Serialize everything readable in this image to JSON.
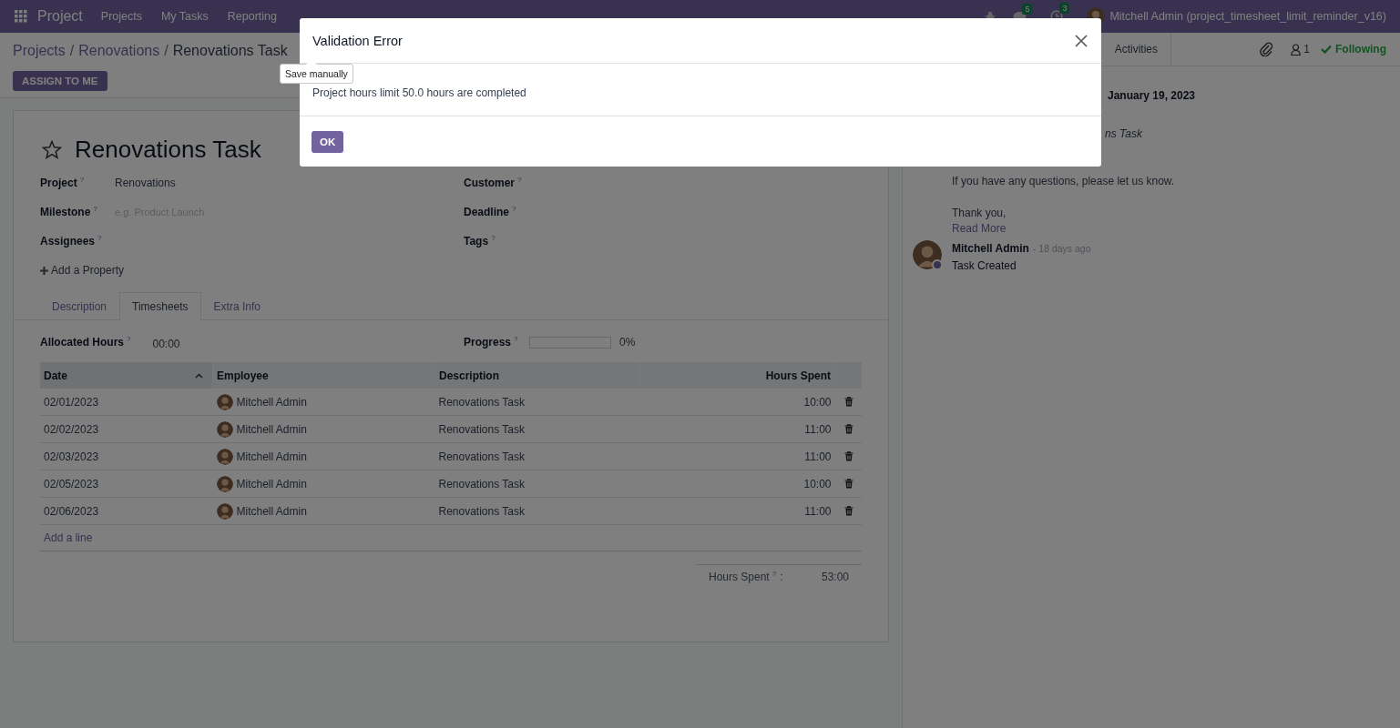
{
  "navbar": {
    "app": "Project",
    "menu": [
      "Projects",
      "My Tasks",
      "Reporting"
    ],
    "messages_count": "5",
    "activities_count": "3",
    "user": "Mitchell Admin (project_timesheet_limit_reminder_v16)"
  },
  "breadcrumb": {
    "items": [
      "Projects",
      "Renovations",
      "Renovations Task"
    ],
    "separator": "/"
  },
  "assign_button": "ASSIGN TO ME",
  "task": {
    "starred": false,
    "title": "Renovations Task",
    "fields_left": [
      {
        "label": "Project",
        "help": "?",
        "value": "Renovations"
      },
      {
        "label": "Milestone",
        "help": "?",
        "placeholder": "e.g. Product Launch"
      },
      {
        "label": "Assignees",
        "help": "?"
      }
    ],
    "fields_right": [
      {
        "label": "Customer",
        "help": "?"
      },
      {
        "label": "Deadline",
        "help": "?"
      },
      {
        "label": "Tags",
        "help": "?"
      }
    ],
    "add_property": "Add a Property"
  },
  "tabs": [
    {
      "label": "Description",
      "selected": false
    },
    {
      "label": "Timesheets",
      "selected": true
    },
    {
      "label": "Extra Info",
      "selected": false
    }
  ],
  "allocated_hours": {
    "label": "Allocated Hours",
    "help": "?",
    "value": "00:00"
  },
  "progress": {
    "label": "Progress",
    "help": "?",
    "level": 0,
    "reading": "0%"
  },
  "table": {
    "columns": [
      {
        "label": "Date",
        "sorted": true
      },
      {
        "label": "Employee",
        "sorted": false
      },
      {
        "label": "Description",
        "sorted": false
      },
      {
        "label": "Hours Spent",
        "sorted": false
      }
    ],
    "rows": [
      {
        "date": "02/01/2023",
        "employee": "Mitchell Admin",
        "description": "Renovations Task",
        "hours": "10:00"
      },
      {
        "date": "02/02/2023",
        "employee": "Mitchell Admin",
        "description": "Renovations Task",
        "hours": "11:00"
      },
      {
        "date": "02/03/2023",
        "employee": "Mitchell Admin",
        "description": "Renovations Task",
        "hours": "11:00"
      },
      {
        "date": "02/05/2023",
        "employee": "Mitchell Admin",
        "description": "Renovations Task",
        "hours": "10:00"
      },
      {
        "date": "02/06/2023",
        "employee": "Mitchell Admin",
        "description": "Renovations Task",
        "hours": "11:00"
      }
    ],
    "add_line": "Add a line"
  },
  "total": {
    "label": "Hours Spent",
    "help": "?",
    "colon": ":",
    "value": "53:00"
  },
  "chatter": {
    "activities": "Activities",
    "followers": "1",
    "following": "Following",
    "date": "January 19, 2023",
    "message_fragment": "ns Task",
    "message_paragraphs": [
      [
        "If you have any questions, please let us know."
      ],
      [
        "Thank you,"
      ]
    ],
    "read_more": "Read More",
    "log": {
      "author": "Mitchell Admin",
      "time": "- 18 days ago",
      "body": "Task Created",
      "online": true
    }
  },
  "modal": {
    "title": "Validation Error",
    "message": "Project hours limit 50.0 hours are completed",
    "button": "OK"
  },
  "tooltip": "Save manually"
}
